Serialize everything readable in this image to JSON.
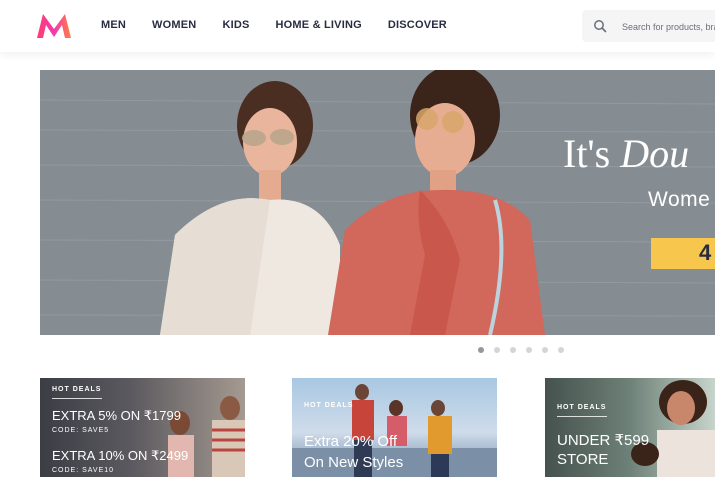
{
  "header": {
    "logo_alt": "Myntra",
    "nav": [
      "MEN",
      "WOMEN",
      "KIDS",
      "HOME & LIVING",
      "DISCOVER"
    ],
    "search_placeholder": "Search for products, brands and more"
  },
  "hero": {
    "title_plain": "It's ",
    "title_italic": "Dou",
    "subtitle": "Wome",
    "badge": "4"
  },
  "carousel": {
    "count": 6,
    "active": 0
  },
  "deals": [
    {
      "tag": "HOT DEALS",
      "lines": [
        "EXTRA 5% ON ₹1799",
        "EXTRA 10% ON ₹2499"
      ],
      "codes": [
        "CODE: SAVE5",
        "CODE: SAVE10"
      ]
    },
    {
      "tag": "HOT DEALS",
      "lines": [
        "Extra 20% Off",
        "On New Styles"
      ]
    },
    {
      "tag": "HOT DEALS",
      "lines": [
        "UNDER ₹599",
        "STORE"
      ]
    }
  ],
  "colors": {
    "brand_pink": "#ff3f6c",
    "brand_orange": "#f13ab1",
    "badge": "#f7c74d"
  }
}
